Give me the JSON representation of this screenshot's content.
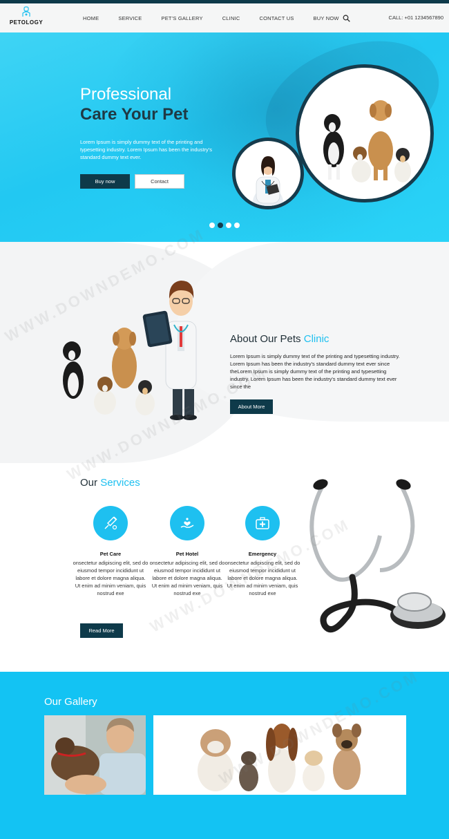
{
  "brand": {
    "name": "PETOLOGY"
  },
  "nav": {
    "items": [
      "HOME",
      "SERVICE",
      "PET'S GALLERY",
      "CLINIC",
      "CONTACT US",
      "BUY NOW"
    ],
    "call": "CALL: +01 1234567890"
  },
  "hero": {
    "title_line1": "Professional",
    "title_line2": "Care Your Pet",
    "text": "Lorem Ipsum is simply dummy text of the printing and typesetting industry. Lorem Ipsum has been the industry's standard dummy text ever.",
    "buy_label": "Buy now",
    "contact_label": "Contact",
    "slides": 4,
    "active_slide": 2
  },
  "about": {
    "title": "About Our Pets ",
    "title_accent": "Clinic",
    "text": "Lorem Ipsum is simply dummy text of the printing and typesetting industry. Lorem Ipsum has been the industry's standard dummy text ever since theLorem Ipsum is simply dummy text of the printing and typesetting industry. Lorem Ipsum has been the industry's standard dummy text ever since the",
    "button_label": "About More"
  },
  "services": {
    "title": "Our ",
    "title_accent": "Services",
    "items": [
      {
        "title": "Pet Care",
        "icon": "syringe-icon",
        "text": "onsectetur adipiscing elit, sed do eiusmod tempor incididunt ut labore et dolore magna aliqua. Ut enim ad minim veniam, quis nostrud exe"
      },
      {
        "title": "Pet Hotel",
        "icon": "hand-heart-icon",
        "text": "onsectetur adipiscing elit, sed do eiusmod tempor incididunt ut labore et dolore magna aliqua. Ut enim ad minim veniam, quis nostrud exe"
      },
      {
        "title": "Emergency",
        "icon": "medical-kit-icon",
        "text": "onsectetur adipiscing elit, sed do eiusmod tempor incididunt ut labore et dolore magna aliqua. Ut enim ad minim veniam, quis nostrud exe"
      }
    ],
    "button_label": "Read More"
  },
  "gallery": {
    "title": "Our Gallery"
  },
  "watermark": "WWW.DOWNDEMO.COM",
  "colors": {
    "accent": "#1ec0f0",
    "dark": "#0e3a4a",
    "hero": "#22c8f2"
  }
}
